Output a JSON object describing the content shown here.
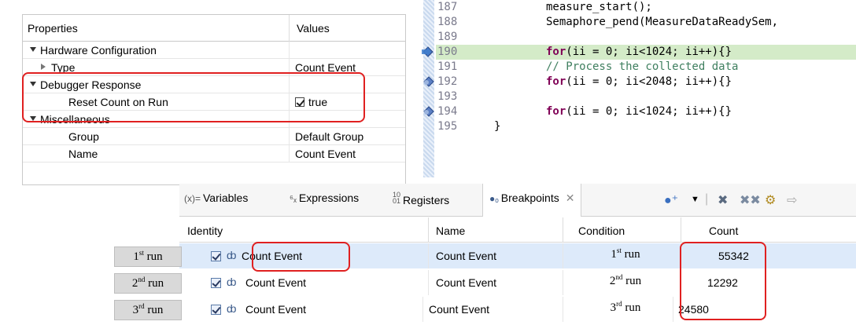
{
  "properties": {
    "headers": {
      "property": "Properties",
      "value": "Values"
    },
    "rows": [
      {
        "key": "Hardware Configuration",
        "value": "",
        "indent": 1,
        "expander": "down"
      },
      {
        "key": "Type",
        "value": "Count Event",
        "indent": 2,
        "expander": "right"
      },
      {
        "key": "Debugger Response",
        "value": "",
        "indent": 1,
        "expander": "down"
      },
      {
        "key": "Reset Count on Run",
        "value": "true",
        "indent": 3,
        "expander": "",
        "checkbox": true
      },
      {
        "key": "Miscellaneous",
        "value": "",
        "indent": 1,
        "expander": "down"
      },
      {
        "key": "Group",
        "value": "Default Group",
        "indent": 3,
        "expander": ""
      },
      {
        "key": "Name",
        "value": "Count Event",
        "indent": 3,
        "expander": ""
      }
    ]
  },
  "editor": {
    "lines": [
      {
        "num": "187",
        "code": "measure_start();"
      },
      {
        "num": "188",
        "code": "Semaphore_pend(MeasureDataReadySem,"
      },
      {
        "num": "189",
        "code": ""
      },
      {
        "num": "190",
        "kw": "for",
        "code": "(ii = 0; ii<1024; ii++){}",
        "highlight": true,
        "marker": "current-breakpoint-icon"
      },
      {
        "num": "191",
        "comment": "// Process the collected data"
      },
      {
        "num": "192",
        "kw": "for",
        "code": "(ii = 0; ii<2048; ii++){}",
        "marker": "breakpoint-icon"
      },
      {
        "num": "193",
        "code": ""
      },
      {
        "num": "194",
        "kw": "for",
        "code": "(ii = 0; ii<1024; ii++){}",
        "marker": "breakpoint-icon"
      },
      {
        "num": "195",
        "code": "}"
      }
    ]
  },
  "breakpoints_view": {
    "tabs": [
      {
        "label": "Variables",
        "icon": "(x)="
      },
      {
        "label": "Expressions",
        "icon": "expressions-icon"
      },
      {
        "label": "Registers",
        "icon": "registers-icon"
      },
      {
        "label": "Breakpoints",
        "icon": "breakpoints-icon",
        "active": true
      }
    ],
    "columns": {
      "identity": "Identity",
      "name": "Name",
      "condition": "Condition",
      "count": "Count"
    },
    "rows": [
      {
        "run_num": "1",
        "run_sup": "st",
        "run_word": "run",
        "identity": "Count Event",
        "name": "Count Event",
        "cond_num": "1",
        "cond_sup": "st",
        "cond_word": "run",
        "count": "55342",
        "selected": true
      },
      {
        "run_num": "2",
        "run_sup": "nd",
        "run_word": "run",
        "identity": "Count Event",
        "name": "Count Event",
        "cond_num": "2",
        "cond_sup": "nd",
        "cond_word": "run",
        "count": "12292"
      },
      {
        "run_num": "3",
        "run_sup": "rd",
        "run_word": "run",
        "identity": "Count Event",
        "name": "Count Event",
        "cond_num": "3",
        "cond_sup": "rd",
        "cond_word": "run",
        "count": "24580"
      }
    ]
  },
  "colors": {
    "annotation": "#e02020",
    "highlight_line": "#d4ebc8",
    "selected_row": "#ddeafa",
    "keyword": "#7f0055",
    "comment": "#3f7f5f"
  }
}
